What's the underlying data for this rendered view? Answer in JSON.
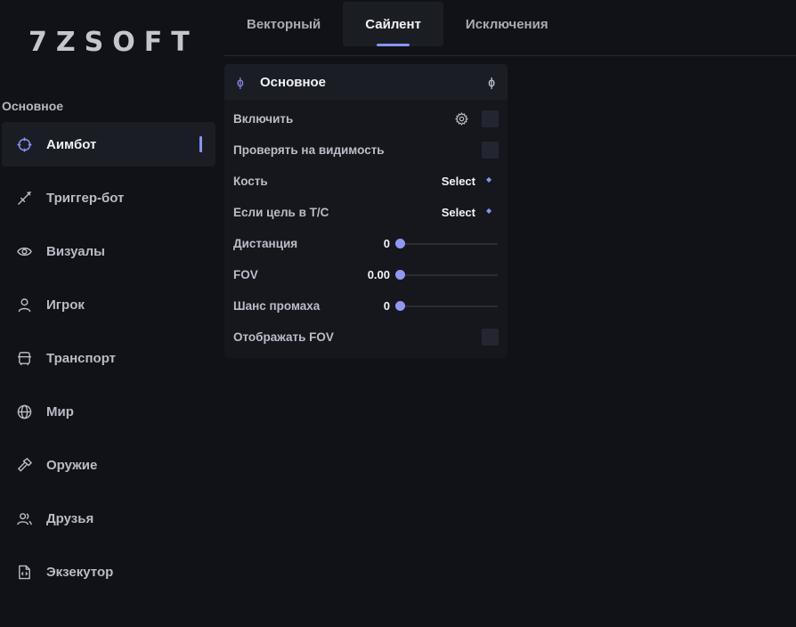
{
  "app": {
    "logo": "7ZSOFT"
  },
  "sidebar": {
    "section_label": "Основное",
    "items": [
      {
        "label": "Аимбот",
        "icon": "crosshair-icon",
        "active": true
      },
      {
        "label": "Триггер-бот",
        "icon": "sword-icon"
      },
      {
        "label": "Визуалы",
        "icon": "eye-icon"
      },
      {
        "label": "Игрок",
        "icon": "user-icon"
      },
      {
        "label": "Транспорт",
        "icon": "car-icon"
      },
      {
        "label": "Мир",
        "icon": "globe-icon"
      },
      {
        "label": "Оружие",
        "icon": "hammer-icon"
      },
      {
        "label": "Друзья",
        "icon": "users-icon"
      },
      {
        "label": "Экзекутор",
        "icon": "code-file-icon"
      }
    ]
  },
  "tabs": [
    {
      "label": "Векторный"
    },
    {
      "label": "Сайлент",
      "active": true
    },
    {
      "label": "Исключения"
    }
  ],
  "panel": {
    "title": "Основное",
    "rows": {
      "enable": {
        "label": "Включить",
        "checked": false
      },
      "visibility": {
        "label": "Проверять на видимость",
        "checked": false
      },
      "bone": {
        "label": "Кость",
        "value": "Select"
      },
      "target_tc": {
        "label": "Если цель в T/C",
        "value": "Select"
      },
      "distance": {
        "label": "Дистанция",
        "value": "0",
        "fraction": 0
      },
      "fov": {
        "label": "FOV",
        "value": "0.00",
        "fraction": 0
      },
      "miss_chance": {
        "label": "Шанс промаха",
        "value": "0",
        "fraction": 0
      },
      "show_fov": {
        "label": "Отображать FOV",
        "checked": false
      }
    }
  },
  "colors": {
    "accent": "#8a92f2",
    "background": "#111217",
    "panel": "#15171d",
    "active_bg": "#1b1d25"
  }
}
